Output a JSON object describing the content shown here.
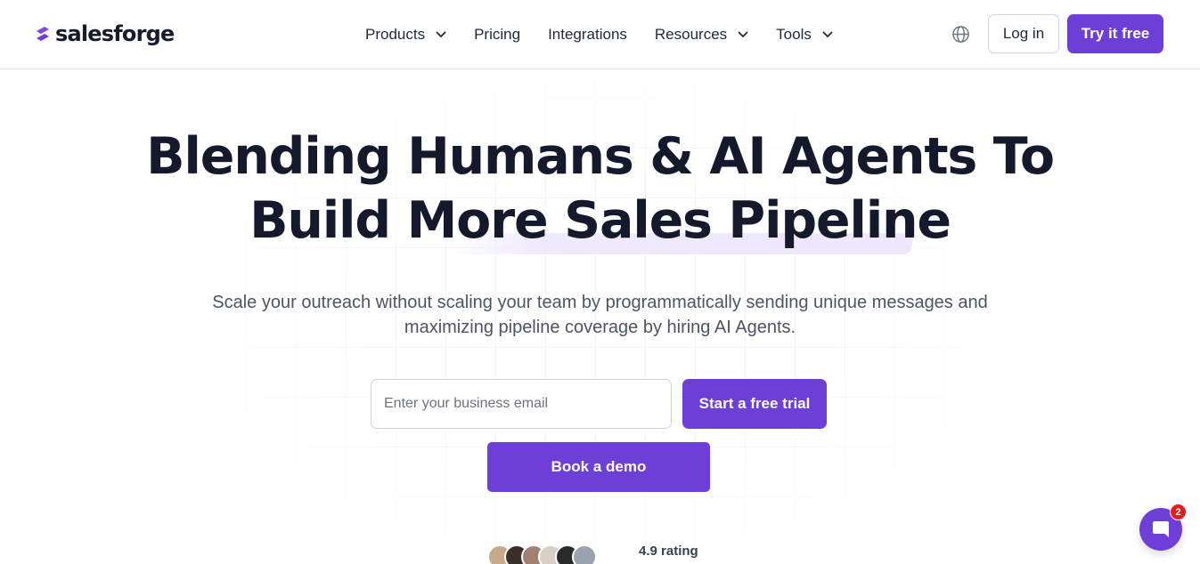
{
  "header": {
    "brand": "salesforge",
    "nav": [
      {
        "label": "Products",
        "has_dropdown": true
      },
      {
        "label": "Pricing",
        "has_dropdown": false
      },
      {
        "label": "Integrations",
        "has_dropdown": false
      },
      {
        "label": "Resources",
        "has_dropdown": true
      },
      {
        "label": "Tools",
        "has_dropdown": true
      }
    ],
    "language_icon": "globe-icon",
    "login_label": "Log in",
    "cta_label": "Try it free"
  },
  "hero": {
    "headline_line1": "Blending Humans & AI Agents To",
    "headline_line2": "Build More Sales Pipeline",
    "subhead_line1": "Scale your outreach without scaling your team by programmatically sending unique messages and",
    "subhead_line2": "maximizing pipeline coverage by hiring AI Agents.",
    "email_placeholder": "Enter your business email",
    "email_value": "",
    "trial_label": "Start a free trial",
    "demo_label": "Book a demo",
    "rating_text": "4.9 rating"
  },
  "chat": {
    "icon": "chat-icon",
    "unread_count": "2"
  },
  "colors": {
    "brand_purple": "#6d3fd6",
    "headline": "#141a2b",
    "body_text": "#4b5563",
    "highlight": "#efe8fd",
    "badge_red": "#e11d1d"
  }
}
